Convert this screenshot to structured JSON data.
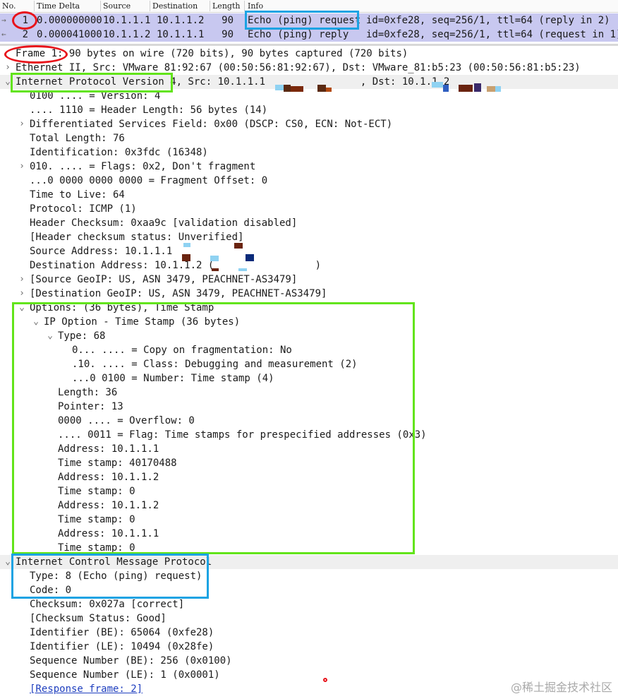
{
  "packet_list": {
    "columns": [
      "No.",
      "Time Delta",
      "Source",
      "Destination",
      "Length",
      "Info"
    ],
    "rows": [
      {
        "no": "1",
        "time": "0.000000000",
        "src": "10.1.1.1",
        "dst": "10.1.1.2",
        "len": "90",
        "info_type": "Echo (ping) request",
        "info_rest": "id=0xfe28, seq=256/1, ttl=64 (reply in 2)"
      },
      {
        "no": "2",
        "time": "0.000041000",
        "src": "10.1.1.2",
        "dst": "10.1.1.1",
        "len": "90",
        "info_type": "Echo (ping) reply",
        "info_rest": "id=0xfe28, seq=256/1, ttl=64 (request in 1)"
      }
    ],
    "arrow_glyphs": [
      "→",
      "←"
    ]
  },
  "details": [
    {
      "depth": 0,
      "toggle": "",
      "text": "Frame 1: 90 bytes on wire (720 bits), 90 bytes captured (720 bits)"
    },
    {
      "depth": 0,
      "toggle": "›",
      "text": "Ethernet II, Src: VMware_81:92:67 (00:50:56:81:92:67), Dst: VMware_81:b5:23 (00:50:56:81:b5:23)"
    },
    {
      "depth": 0,
      "toggle": "⌄",
      "text": "Internet Protocol Version 4, Src: 10.1.1.1                , Dst: 10.1.1.2",
      "hl": true
    },
    {
      "depth": 1,
      "toggle": "",
      "text": "0100 .... = Version: 4"
    },
    {
      "depth": 1,
      "toggle": "",
      "text": ".... 1110 = Header Length: 56 bytes (14)"
    },
    {
      "depth": 1,
      "toggle": "›",
      "text": "Differentiated Services Field: 0x00 (DSCP: CS0, ECN: Not-ECT)"
    },
    {
      "depth": 1,
      "toggle": "",
      "text": "Total Length: 76"
    },
    {
      "depth": 1,
      "toggle": "",
      "text": "Identification: 0x3fdc (16348)"
    },
    {
      "depth": 1,
      "toggle": "›",
      "text": "010. .... = Flags: 0x2, Don't fragment"
    },
    {
      "depth": 1,
      "toggle": "",
      "text": "...0 0000 0000 0000 = Fragment Offset: 0"
    },
    {
      "depth": 1,
      "toggle": "",
      "text": "Time to Live: 64"
    },
    {
      "depth": 1,
      "toggle": "",
      "text": "Protocol: ICMP (1)"
    },
    {
      "depth": 1,
      "toggle": "",
      "text": "Header Checksum: 0xaa9c [validation disabled]"
    },
    {
      "depth": 1,
      "toggle": "",
      "text": "[Header checksum status: Unverified]"
    },
    {
      "depth": 1,
      "toggle": "",
      "text": "Source Address: 10.1.1.1"
    },
    {
      "depth": 1,
      "toggle": "",
      "text": "Destination Address: 10.1.1.2 (                 )"
    },
    {
      "depth": 1,
      "toggle": "›",
      "text": "[Source GeoIP: US, ASN 3479, PEACHNET-AS3479]"
    },
    {
      "depth": 1,
      "toggle": "›",
      "text": "[Destination GeoIP: US, ASN 3479, PEACHNET-AS3479]"
    },
    {
      "depth": 1,
      "toggle": "⌄",
      "text": "Options: (36 bytes), Time Stamp"
    },
    {
      "depth": 2,
      "toggle": "⌄",
      "text": "IP Option - Time Stamp (36 bytes)"
    },
    {
      "depth": 3,
      "toggle": "⌄",
      "text": "Type: 68"
    },
    {
      "depth": 4,
      "toggle": "",
      "text": "0... .... = Copy on fragmentation: No"
    },
    {
      "depth": 4,
      "toggle": "",
      "text": ".10. .... = Class: Debugging and measurement (2)"
    },
    {
      "depth": 4,
      "toggle": "",
      "text": "...0 0100 = Number: Time stamp (4)"
    },
    {
      "depth": 3,
      "toggle": "",
      "text": "Length: 36"
    },
    {
      "depth": 3,
      "toggle": "",
      "text": "Pointer: 13"
    },
    {
      "depth": 3,
      "toggle": "",
      "text": "0000 .... = Overflow: 0"
    },
    {
      "depth": 3,
      "toggle": "",
      "text": ".... 0011 = Flag: Time stamps for prespecified addresses (0x3)"
    },
    {
      "depth": 3,
      "toggle": "",
      "text": "Address: 10.1.1.1"
    },
    {
      "depth": 3,
      "toggle": "",
      "text": "Time stamp: 40170488"
    },
    {
      "depth": 3,
      "toggle": "",
      "text": "Address: 10.1.1.2"
    },
    {
      "depth": 3,
      "toggle": "",
      "text": "Time stamp: 0"
    },
    {
      "depth": 3,
      "toggle": "",
      "text": "Address: 10.1.1.2"
    },
    {
      "depth": 3,
      "toggle": "",
      "text": "Time stamp: 0"
    },
    {
      "depth": 3,
      "toggle": "",
      "text": "Address: 10.1.1.1"
    },
    {
      "depth": 3,
      "toggle": "",
      "text": "Time stamp: 0"
    },
    {
      "depth": 0,
      "toggle": "⌄",
      "text": "Internet Control Message Protocol",
      "hl": true
    },
    {
      "depth": 1,
      "toggle": "",
      "text": "Type: 8 (Echo (ping) request)"
    },
    {
      "depth": 1,
      "toggle": "",
      "text": "Code: 0"
    },
    {
      "depth": 1,
      "toggle": "",
      "text": "Checksum: 0x027a [correct]"
    },
    {
      "depth": 1,
      "toggle": "",
      "text": "[Checksum Status: Good]"
    },
    {
      "depth": 1,
      "toggle": "",
      "text": "Identifier (BE): 65064 (0xfe28)"
    },
    {
      "depth": 1,
      "toggle": "",
      "text": "Identifier (LE): 10494 (0x28fe)"
    },
    {
      "depth": 1,
      "toggle": "",
      "text": "Sequence Number (BE): 256 (0x0100)"
    },
    {
      "depth": 1,
      "toggle": "",
      "text": "Sequence Number (LE): 1 (0x0001)"
    },
    {
      "depth": 1,
      "toggle": "",
      "text": "[Response frame: 2]",
      "link": true
    }
  ],
  "watermark": "@稀土掘金技术社区",
  "colors": {
    "selected_row": "#c8c8f0",
    "annotation_red": "#e8131b",
    "annotation_cyan": "#1ba3e3",
    "annotation_green": "#62e41a",
    "link": "#1f3fbf"
  }
}
